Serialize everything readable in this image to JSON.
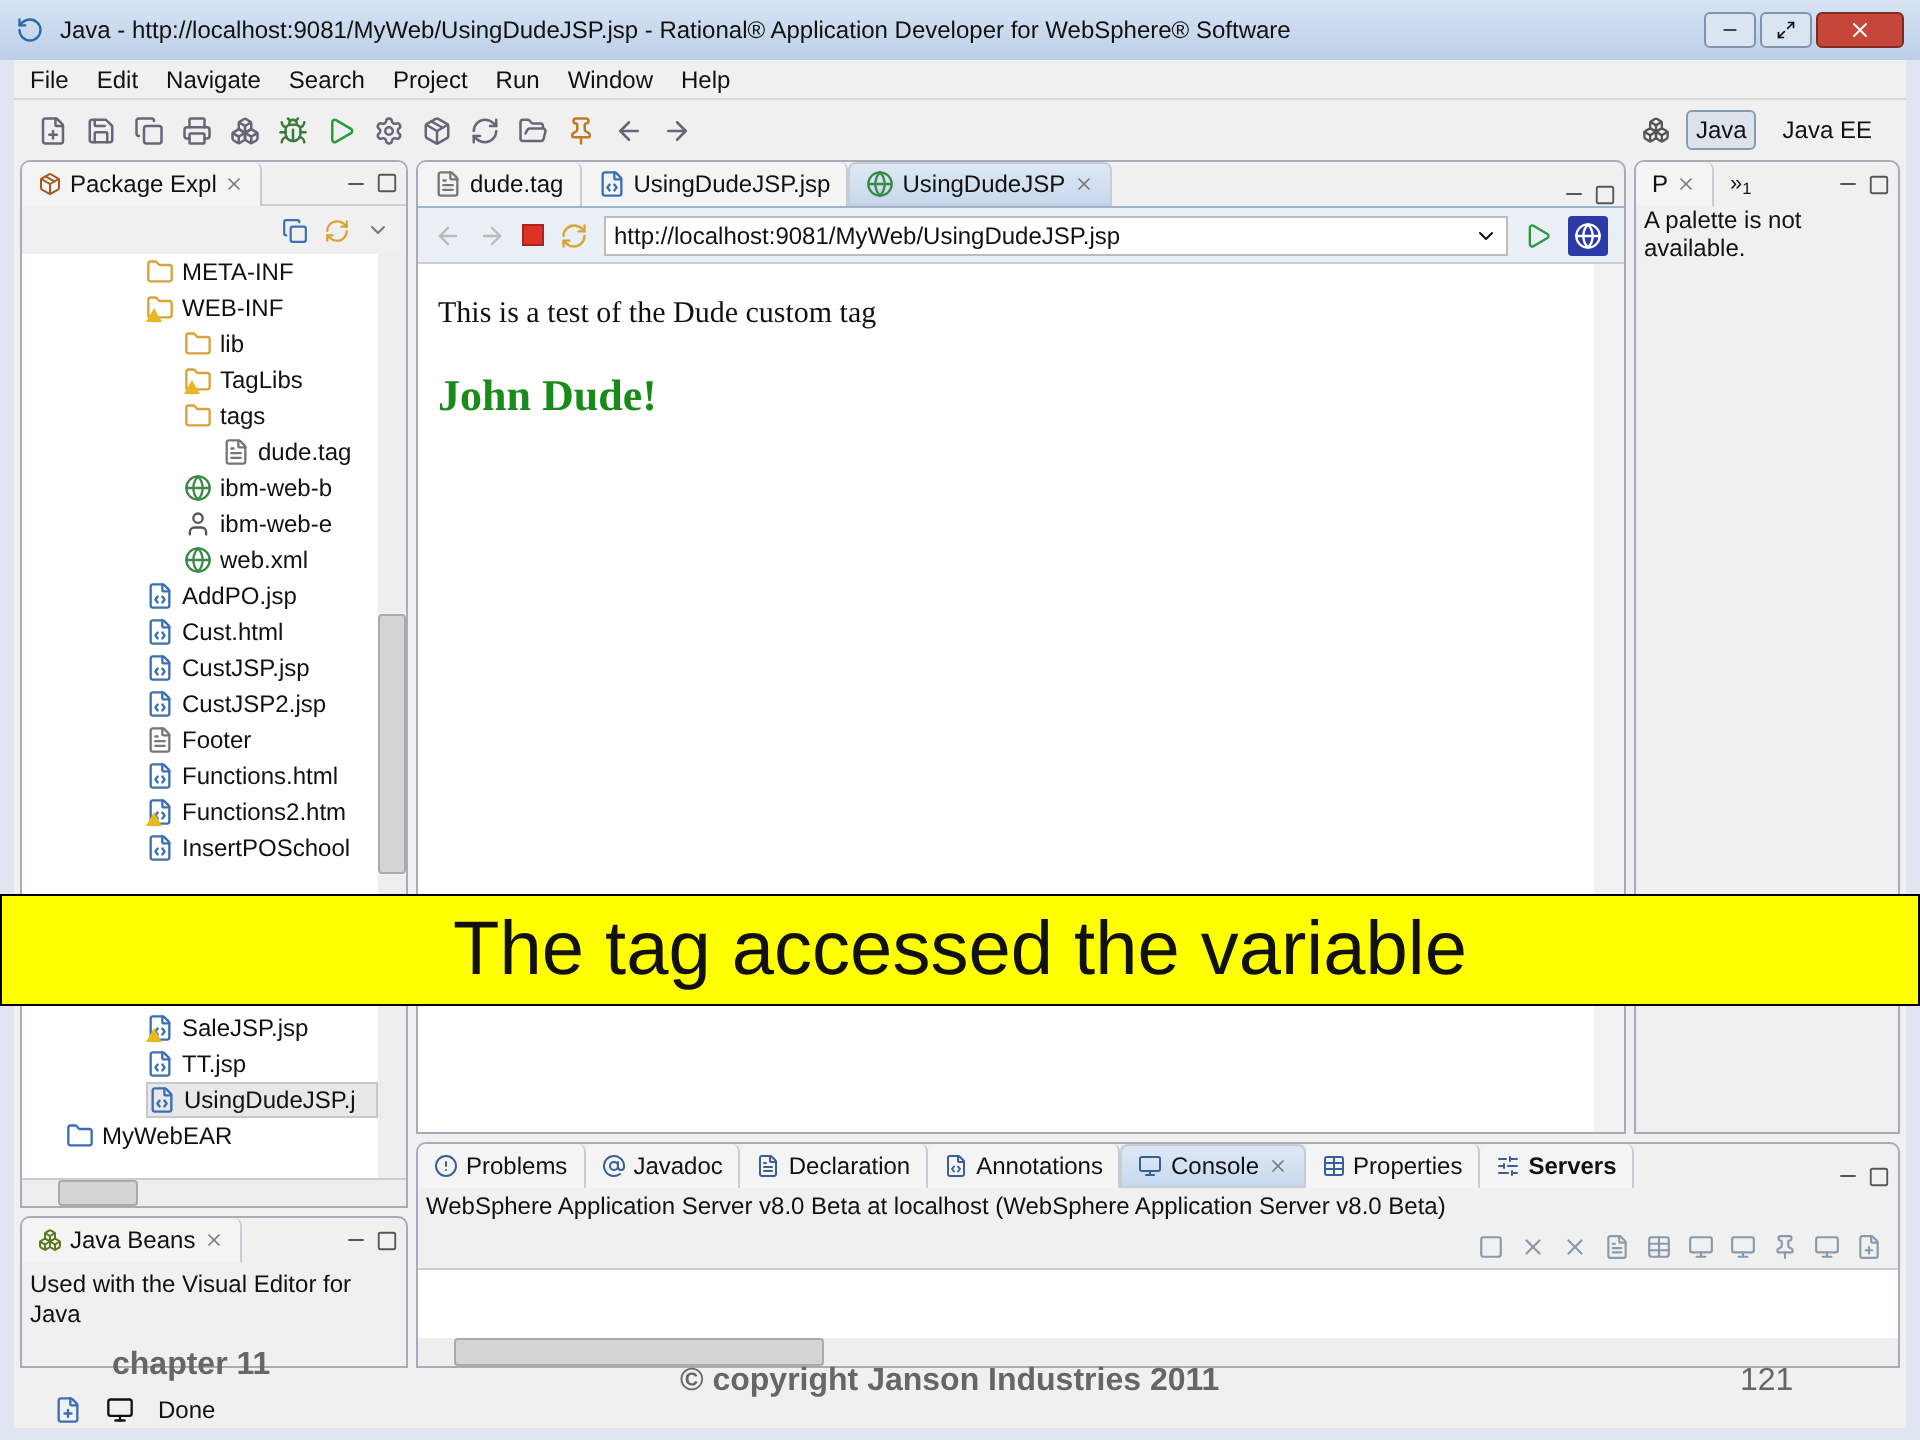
{
  "window": {
    "title": "Java - http://localhost:9081/MyWeb/UsingDudeJSP.jsp - Rational® Application Developer for WebSphere® Software"
  },
  "menu": [
    "File",
    "Edit",
    "Navigate",
    "Search",
    "Project",
    "Run",
    "Window",
    "Help"
  ],
  "perspectives": [
    {
      "label": "Java",
      "selected": true
    },
    {
      "label": "Java EE",
      "selected": false
    }
  ],
  "package_explorer": {
    "tab": "Package Expl",
    "items": [
      {
        "label": "META-INF",
        "kind": "folder",
        "warning": false,
        "selected": false
      },
      {
        "label": "WEB-INF",
        "kind": "folder",
        "warning": true,
        "selected": false,
        "children": [
          {
            "label": "lib",
            "kind": "folder",
            "warning": false,
            "selected": false
          },
          {
            "label": "TagLibs",
            "kind": "folder",
            "warning": true,
            "selected": false
          },
          {
            "label": "tags",
            "kind": "folder",
            "warning": false,
            "selected": false,
            "children": [
              {
                "label": "dude.tag",
                "kind": "file",
                "warning": false,
                "selected": false
              }
            ]
          },
          {
            "label": "ibm-web-b",
            "kind": "globe",
            "warning": false,
            "selected": false
          },
          {
            "label": "ibm-web-e",
            "kind": "person",
            "warning": false,
            "selected": false
          },
          {
            "label": "web.xml",
            "kind": "globe",
            "warning": false,
            "selected": false
          }
        ]
      },
      {
        "label": "AddPO.jsp",
        "kind": "jsp",
        "warning": false,
        "selected": false
      },
      {
        "label": "Cust.html",
        "kind": "jsp",
        "warning": false,
        "selected": false
      },
      {
        "label": "CustJSP.jsp",
        "kind": "jsp",
        "warning": false,
        "selected": false
      },
      {
        "label": "CustJSP2.jsp",
        "kind": "jsp",
        "warning": false,
        "selected": false
      },
      {
        "label": "Footer",
        "kind": "file",
        "warning": false,
        "selected": false
      },
      {
        "label": "Functions.html",
        "kind": "jsp",
        "warning": false,
        "selected": false
      },
      {
        "label": "Functions2.htm",
        "kind": "jsp",
        "warning": true,
        "selected": false
      },
      {
        "label": "InsertPOSchool",
        "kind": "jsp",
        "warning": false,
        "selected": false
      },
      {
        "label": "SaleJSP.jsp",
        "kind": "jsp",
        "warning": true,
        "selected": false
      },
      {
        "label": "TT.jsp",
        "kind": "jsp",
        "warning": false,
        "selected": false
      },
      {
        "label": "UsingDudeJSP.j",
        "kind": "jsp",
        "warning": false,
        "selected": true
      }
    ],
    "project": "MyWebEAR"
  },
  "java_beans": {
    "tab": "Java Beans",
    "text": "Used with the Visual Editor for Java"
  },
  "editor": {
    "tabs": [
      {
        "label": "dude.tag",
        "kind": "file",
        "selected": false
      },
      {
        "label": "UsingDudeJSP.jsp",
        "kind": "jsp",
        "selected": false
      },
      {
        "label": "UsingDudeJSP",
        "kind": "globe",
        "selected": true
      }
    ],
    "url": "http://localhost:9081/MyWeb/UsingDudeJSP.jsp",
    "page_text": "This is a test of the Dude custom tag",
    "page_heading": "John Dude!"
  },
  "palette": {
    "tab": "P",
    "overflow": "»",
    "overflow_count": "1",
    "text": "A palette is not available."
  },
  "bottom": {
    "tabs": [
      {
        "label": "Problems",
        "selected": false,
        "bold": false
      },
      {
        "label": "Javadoc",
        "selected": false,
        "bold": false
      },
      {
        "label": "Declaration",
        "selected": false,
        "bold": false
      },
      {
        "label": "Annotations",
        "selected": false,
        "bold": false
      },
      {
        "label": "Console",
        "selected": true,
        "bold": false
      },
      {
        "label": "Properties",
        "selected": false,
        "bold": false
      },
      {
        "label": "Servers",
        "selected": false,
        "bold": true
      }
    ],
    "console_title": "WebSphere Application Server v8.0 Beta at localhost (WebSphere Application Server v8.0 Beta)"
  },
  "status": {
    "text": "Done"
  },
  "slide": {
    "banner": "The tag accessed the variable",
    "chapter": "chapter 11",
    "copyright": "© copyright Janson Industries 2011",
    "page": "121"
  }
}
